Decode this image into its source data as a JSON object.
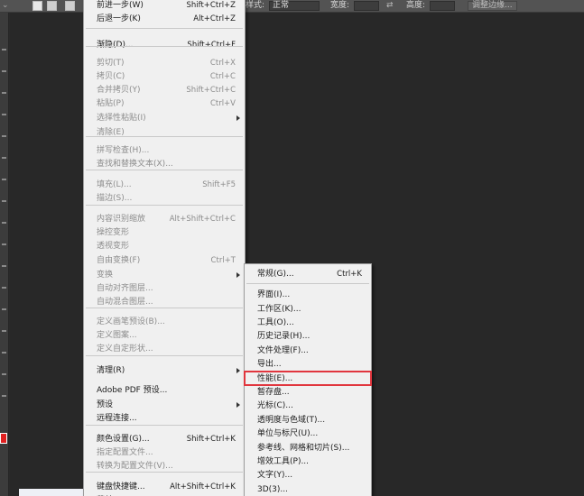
{
  "options_bar": {
    "style_label": "样式:",
    "style_value": "正常",
    "width_label": "宽度:",
    "height_label": "高度:",
    "adjust_edge_label": "调整边缘..."
  },
  "edit_menu": {
    "items": [
      {
        "label": "前进一步(W)",
        "shortcut": "Shift+Ctrl+Z",
        "disabled": false
      },
      {
        "label": "后退一步(K)",
        "shortcut": "Alt+Ctrl+Z",
        "disabled": false
      },
      {
        "label": "渐隐(D)...",
        "shortcut": "Shift+Ctrl+F",
        "disabled": false
      },
      {
        "label": "剪切(T)",
        "shortcut": "Ctrl+X",
        "disabled": true
      },
      {
        "label": "拷贝(C)",
        "shortcut": "Ctrl+C",
        "disabled": true
      },
      {
        "label": "合并拷贝(Y)",
        "shortcut": "Shift+Ctrl+C",
        "disabled": true
      },
      {
        "label": "粘贴(P)",
        "shortcut": "Ctrl+V",
        "disabled": true
      },
      {
        "label": "选择性粘贴(I)",
        "shortcut": "",
        "disabled": true
      },
      {
        "label": "清除(E)",
        "shortcut": "",
        "disabled": true
      },
      {
        "label": "拼写检查(H)...",
        "shortcut": "",
        "disabled": true
      },
      {
        "label": "查找和替换文本(X)...",
        "shortcut": "",
        "disabled": true
      },
      {
        "label": "填充(L)...",
        "shortcut": "Shift+F5",
        "disabled": true
      },
      {
        "label": "描边(S)...",
        "shortcut": "",
        "disabled": true
      },
      {
        "label": "内容识别缩放",
        "shortcut": "Alt+Shift+Ctrl+C",
        "disabled": true
      },
      {
        "label": "操控变形",
        "shortcut": "",
        "disabled": true
      },
      {
        "label": "透视变形",
        "shortcut": "",
        "disabled": true
      },
      {
        "label": "自由变换(F)",
        "shortcut": "Ctrl+T",
        "disabled": true
      },
      {
        "label": "变换",
        "shortcut": "",
        "disabled": true
      },
      {
        "label": "自动对齐图层...",
        "shortcut": "",
        "disabled": true
      },
      {
        "label": "自动混合图层...",
        "shortcut": "",
        "disabled": true
      },
      {
        "label": "定义画笔预设(B)...",
        "shortcut": "",
        "disabled": true
      },
      {
        "label": "定义图案...",
        "shortcut": "",
        "disabled": true
      },
      {
        "label": "定义自定形状...",
        "shortcut": "",
        "disabled": true
      },
      {
        "label": "清理(R)",
        "shortcut": "",
        "disabled": false
      },
      {
        "label": "Adobe PDF 预设...",
        "shortcut": "",
        "disabled": false
      },
      {
        "label": "预设",
        "shortcut": "",
        "disabled": false
      },
      {
        "label": "远程连接...",
        "shortcut": "",
        "disabled": false
      },
      {
        "label": "颜色设置(G)...",
        "shortcut": "Shift+Ctrl+K",
        "disabled": false
      },
      {
        "label": "指定配置文件...",
        "shortcut": "",
        "disabled": true
      },
      {
        "label": "转换为配置文件(V)...",
        "shortcut": "",
        "disabled": true
      },
      {
        "label": "键盘快捷键...",
        "shortcut": "Alt+Shift+Ctrl+K",
        "disabled": false
      },
      {
        "label": "菜单(U)...",
        "shortcut": "Alt+Shift+Ctrl+M",
        "disabled": false
      }
    ]
  },
  "preferences_menu": {
    "items": [
      {
        "label": "常规(G)...",
        "shortcut": "Ctrl+K"
      },
      {
        "label": "界面(I)..."
      },
      {
        "label": "工作区(K)..."
      },
      {
        "label": "工具(O)..."
      },
      {
        "label": "历史记录(H)..."
      },
      {
        "label": "文件处理(F)..."
      },
      {
        "label": "导出..."
      },
      {
        "label": "性能(E)..."
      },
      {
        "label": "暂存盘..."
      },
      {
        "label": "光标(C)..."
      },
      {
        "label": "透明度与色域(T)..."
      },
      {
        "label": "单位与标尺(U)..."
      },
      {
        "label": "参考线、网格和切片(S)..."
      },
      {
        "label": "增效工具(P)..."
      },
      {
        "label": "文字(Y)..."
      },
      {
        "label": "3D(3)..."
      }
    ],
    "highlighted": "性能(E)..."
  },
  "colors": {
    "highlight_border": "#e1363e",
    "menu_bg": "#f0f0f0",
    "workspace_bg": "#282828"
  }
}
